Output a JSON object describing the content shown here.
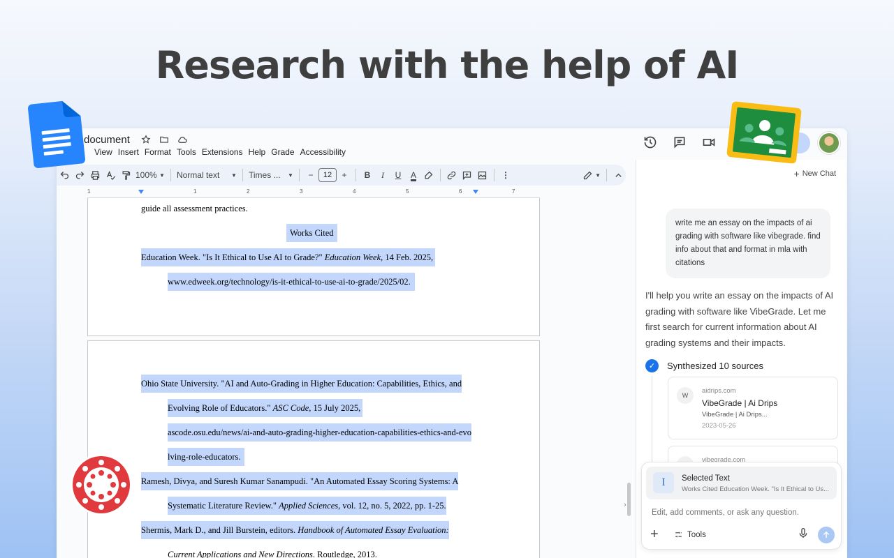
{
  "headline": "Research with the help of AI",
  "docs": {
    "title": "document",
    "menu": [
      "View",
      "Insert",
      "Format",
      "Tools",
      "Extensions",
      "Help",
      "Grade",
      "Accessibility"
    ],
    "toolbar": {
      "zoom": "100%",
      "style": "Normal text",
      "font": "Times ...",
      "font_size": "12"
    },
    "ruler_numbers": [
      "1",
      "1",
      "2",
      "3",
      "4",
      "5",
      "6",
      "7"
    ],
    "page1": {
      "line1": "guide all assessment practices.",
      "works_cited": "Works Cited",
      "entry1_a": "Education Week. \"Is It Ethical to Use AI to Grade?\" ",
      "entry1_a_italic": "Education Week",
      "entry1_a_end": ", 14 Feb. 2025,",
      "entry1_b": "www.edweek.org/technology/is-it-ethical-to-use-ai-to-grade/2025/02."
    },
    "page2": {
      "e2_l1": "Ohio State University. \"AI and Auto-Grading in Higher Education: Capabilities, Ethics, and",
      "e2_l2_a": "Evolving Role of Educators.\" ",
      "e2_l2_i": "ASC Code",
      "e2_l2_b": ", 15 July 2025,",
      "e2_l3": "ascode.osu.edu/news/ai-and-auto-grading-higher-education-capabilities-ethics-and-evo",
      "e2_l4": "lving-role-educators.",
      "e3_l1": "Ramesh, Divya, and Suresh Kumar Sanampudi. \"An Automated Essay Scoring Systems: A",
      "e3_l2_a": "Systematic Literature Review.\" ",
      "e3_l2_i": "Applied Sciences",
      "e3_l2_b": ", vol. 12, no. 5, 2022, pp. 1-25.",
      "e4_l1_a": "Shermis, Mark D., and Jill Burstein, editors. ",
      "e4_l1_i": "Handbook of Automated Essay Evaluation:",
      "e4_l2_i": "Current Applications and New Directions",
      "e4_l2_b": ". Routledge, 2013."
    }
  },
  "chat": {
    "new_chat": "New Chat",
    "user_message": "write me an essay on the impacts of ai grading with software like vibegrade. find info about that and format in mla with citations",
    "ai_message": "I'll help you write an essay on the impacts of AI grading with software like VibeGrade. Let me first search for current information about AI grading systems and their impacts.",
    "synthesized": "Synthesized 10 sources",
    "sources": [
      {
        "fav": "W",
        "domain": "aidrips.com",
        "title": "VibeGrade | Ai Drips",
        "desc": "VibeGrade | Ai Drips...",
        "date": "2023-05-26"
      },
      {
        "fav": "",
        "domain": "vibegrade.com",
        "title": "",
        "desc": "",
        "date": ""
      }
    ],
    "selected": {
      "title": "Selected Text",
      "preview": "Works Cited Education Week. \"Is It Ethical to Us..."
    },
    "input_placeholder": "Edit, add comments, or ask any question.",
    "tools_label": "Tools"
  },
  "colors": {
    "highlight": "#c2d7fb",
    "accent": "#1a73e8",
    "canvas_red": "#e0393e",
    "classroom_green": "#1e8e3e",
    "classroom_yellow": "#f9bc15",
    "docs_blue": "#2684fc"
  },
  "icons": [
    "star-icon",
    "folder-move-icon",
    "cloud-saved-icon",
    "undo-icon",
    "redo-icon",
    "print-icon",
    "spellcheck-icon",
    "paint-format-icon",
    "bold-icon",
    "italic-icon",
    "underline-icon",
    "text-color-icon",
    "highlight-icon",
    "link-icon",
    "comment-icon",
    "image-icon",
    "more-icon",
    "edit-mode-icon",
    "collapse-icon",
    "history-icon",
    "comments-icon",
    "meet-icon",
    "plus-icon",
    "check-icon",
    "text-cursor-icon",
    "tools-icon",
    "mic-icon",
    "send-icon"
  ]
}
